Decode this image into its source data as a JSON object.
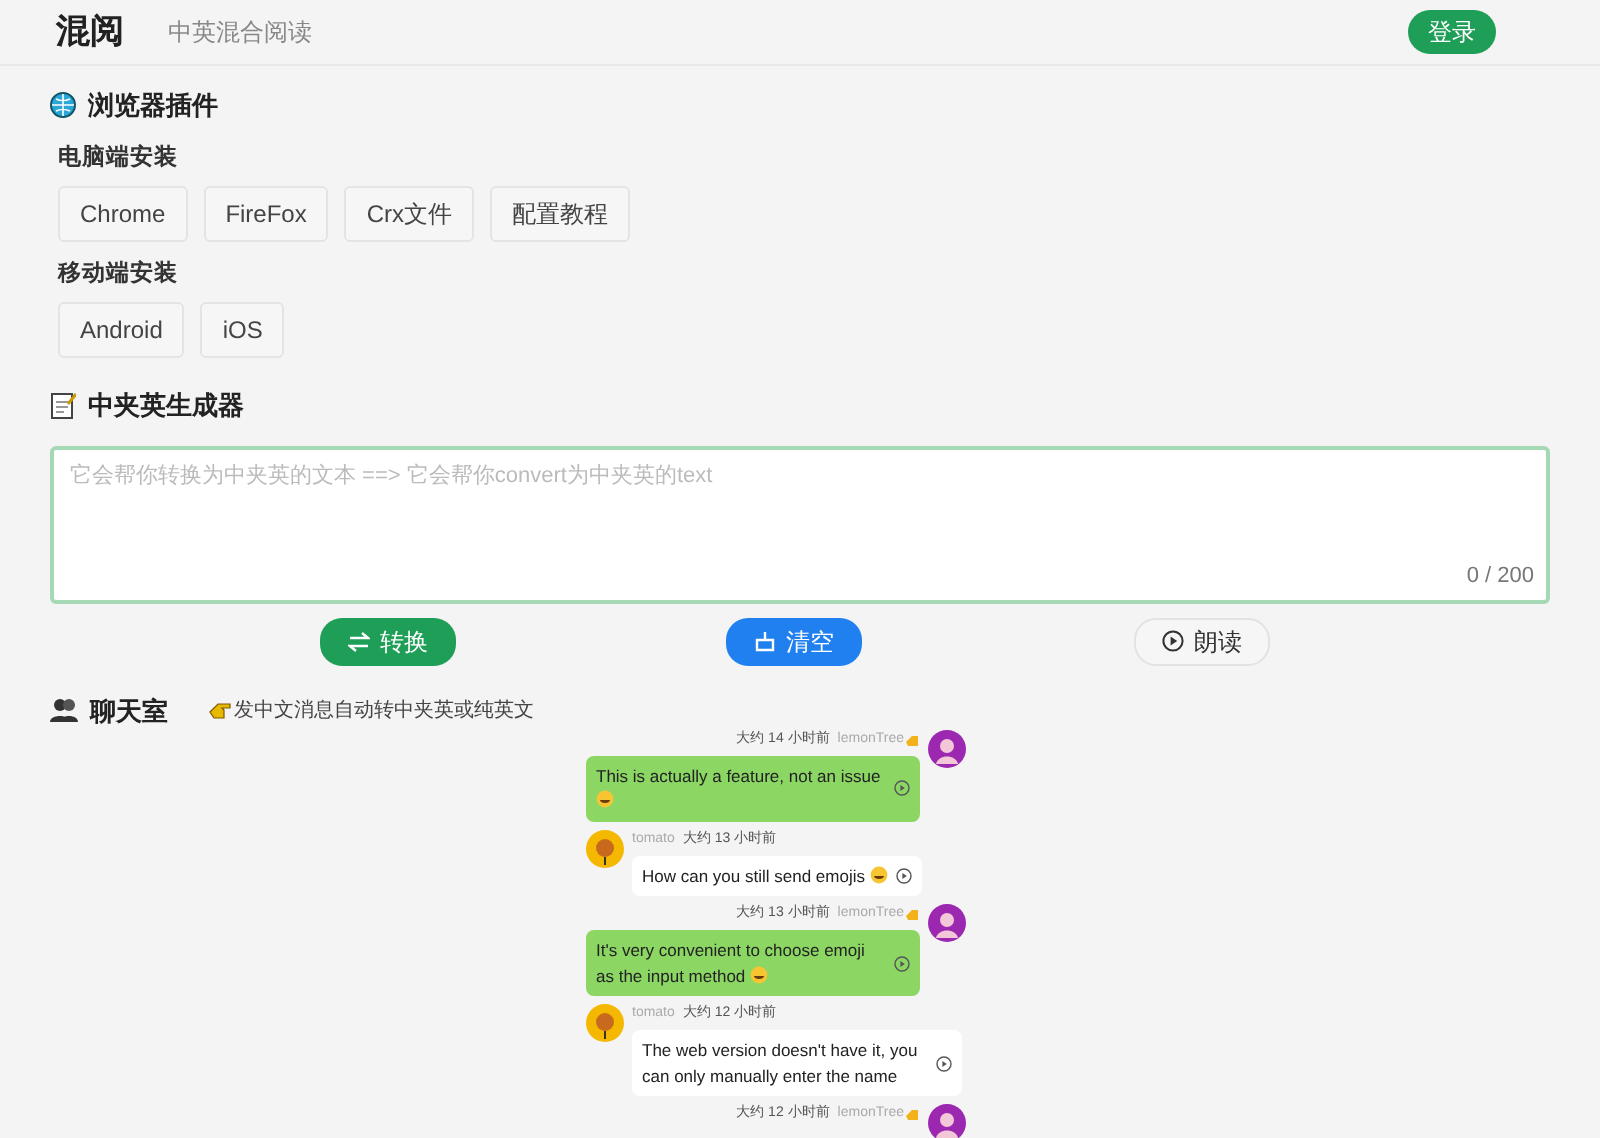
{
  "header": {
    "title": "混阅",
    "subtitle": "中英混合阅读",
    "login": "登录"
  },
  "plugins": {
    "title": "浏览器插件",
    "groups": [
      {
        "label": "电脑端安装",
        "buttons": [
          "Chrome",
          "FireFox",
          "Crx文件",
          "配置教程"
        ]
      },
      {
        "label": "移动端安装",
        "buttons": [
          "Android",
          "iOS"
        ]
      }
    ]
  },
  "generator": {
    "title": "中夹英生成器",
    "placeholder": "它会帮你转换为中夹英的文本 ==> 它会帮你convert为中夹英的text",
    "counter": "0 / 200",
    "actions": [
      {
        "label": "转换",
        "kind": "convert"
      },
      {
        "label": "清空",
        "kind": "clear"
      },
      {
        "label": "朗读",
        "kind": "read"
      }
    ]
  },
  "chat": {
    "title": "聊天室",
    "hint": "发中文消息自动转中夹英或纯英文",
    "messages": [
      {
        "kind": "own",
        "user": "lemonTree",
        "hand_badge": true,
        "time": "大约 14 小时前",
        "text": "This is actually a feature, not an issue",
        "emoji": true
      },
      {
        "kind": "other",
        "user": "tomato",
        "hand_badge": false,
        "time": "大约 13 小时前",
        "text": "How can you still send emojis",
        "emoji": true
      },
      {
        "kind": "own",
        "user": "lemonTree",
        "hand_badge": true,
        "time": "大约 13 小时前",
        "text": "It's very convenient to choose emoji as the input method",
        "emoji": true
      },
      {
        "kind": "other",
        "user": "tomato",
        "hand_badge": false,
        "time": "大约 12 小时前",
        "text": "The web version doesn't have it, you can only manually enter the name",
        "emoji": false
      },
      {
        "kind": "own",
        "user": "lemonTree",
        "hand_badge": true,
        "time": "大约 12 小时前"
      }
    ]
  }
}
